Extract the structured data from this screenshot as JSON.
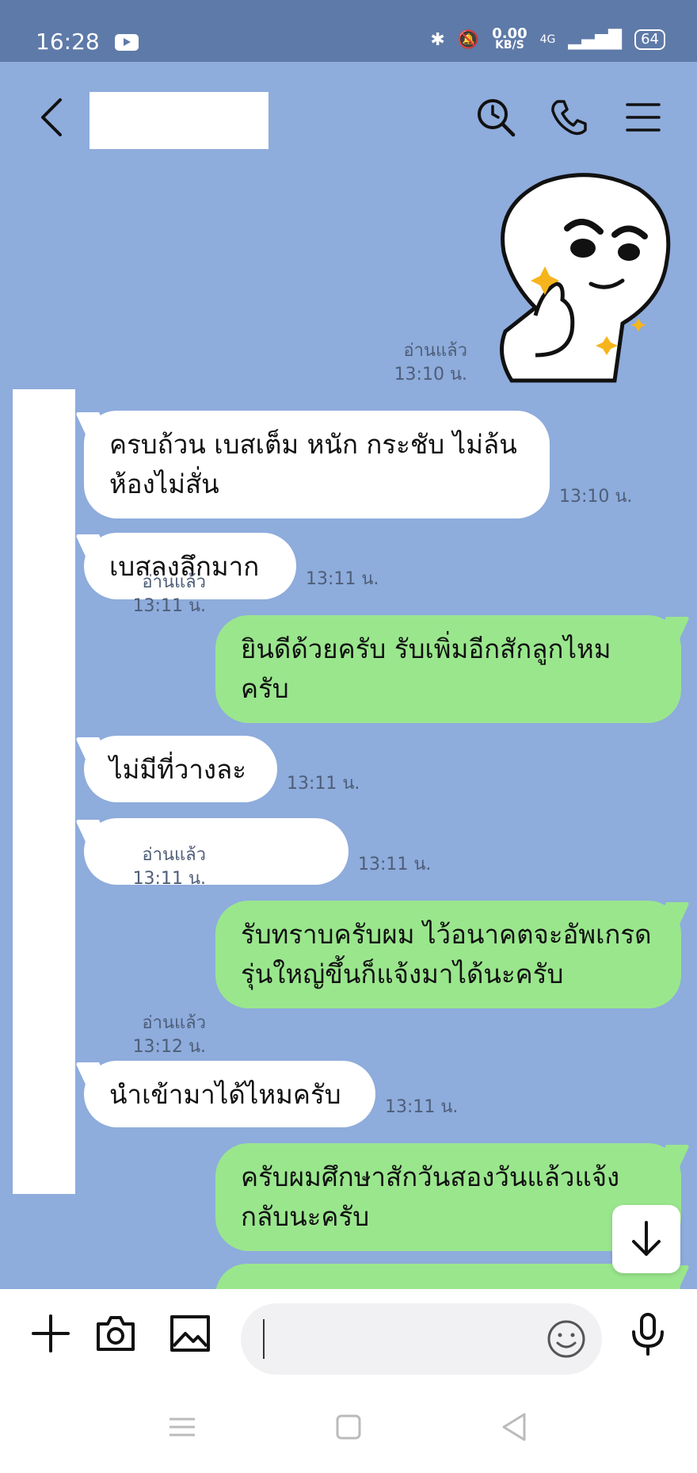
{
  "status_bar": {
    "time": "16:28",
    "net_speed": "0.00",
    "net_unit": "KB/S",
    "network": "4G",
    "battery": "64"
  },
  "header": {
    "icons": [
      "back-icon",
      "search-icon",
      "phone-icon",
      "menu-icon"
    ]
  },
  "messages": [
    {
      "id": "m0",
      "side": "out",
      "type": "sticker",
      "read": "อ่านแล้ว",
      "time": "13:10 น."
    },
    {
      "id": "m1",
      "side": "in",
      "text": "ครบถ้วน เบสเต็ม หนัก กระชับ ไม่ล้น ห้องไม่สั่น",
      "time": "13:10 น."
    },
    {
      "id": "m2",
      "side": "in",
      "text": "เบสลงลึกมาก",
      "time": "13:11 น."
    },
    {
      "id": "m3",
      "side": "out",
      "text": "ยินดีด้วยครับ รับเพิ่มอีกสักลูกไหมครับ",
      "read": "อ่านแล้ว",
      "time": "13:11 น."
    },
    {
      "id": "m4",
      "side": "in",
      "text": "ไม่มีที่วางละ",
      "time": "13:11 น."
    },
    {
      "id": "m5",
      "side": "in",
      "text": "",
      "time": "13:11 น."
    },
    {
      "id": "m6",
      "side": "out",
      "text": "รับทราบครับผม ไว้อนาคตจะอัพเกรดรุ่นใหญ่ขึ้นก็แจ้งมาได้นะครับ",
      "read": "อ่านแล้ว",
      "time": "13:11 น."
    },
    {
      "id": "m7",
      "side": "in",
      "text": "นำเข้ามาได้ไหมครับ",
      "time": "13:11 น."
    },
    {
      "id": "m8",
      "side": "out",
      "text": "ครับผมศึกษาสักวันสองวันแล้วแจ้งกลับนะครับ",
      "read": "อ่านแล้ว",
      "time": "13:12 น."
    }
  ],
  "input": {
    "placeholder": "",
    "value": ""
  },
  "colors": {
    "chat_bg": "#8eacdc",
    "status_bg": "#5e7aa8",
    "out_bubble": "#9ae68d",
    "in_bubble": "#ffffff"
  }
}
